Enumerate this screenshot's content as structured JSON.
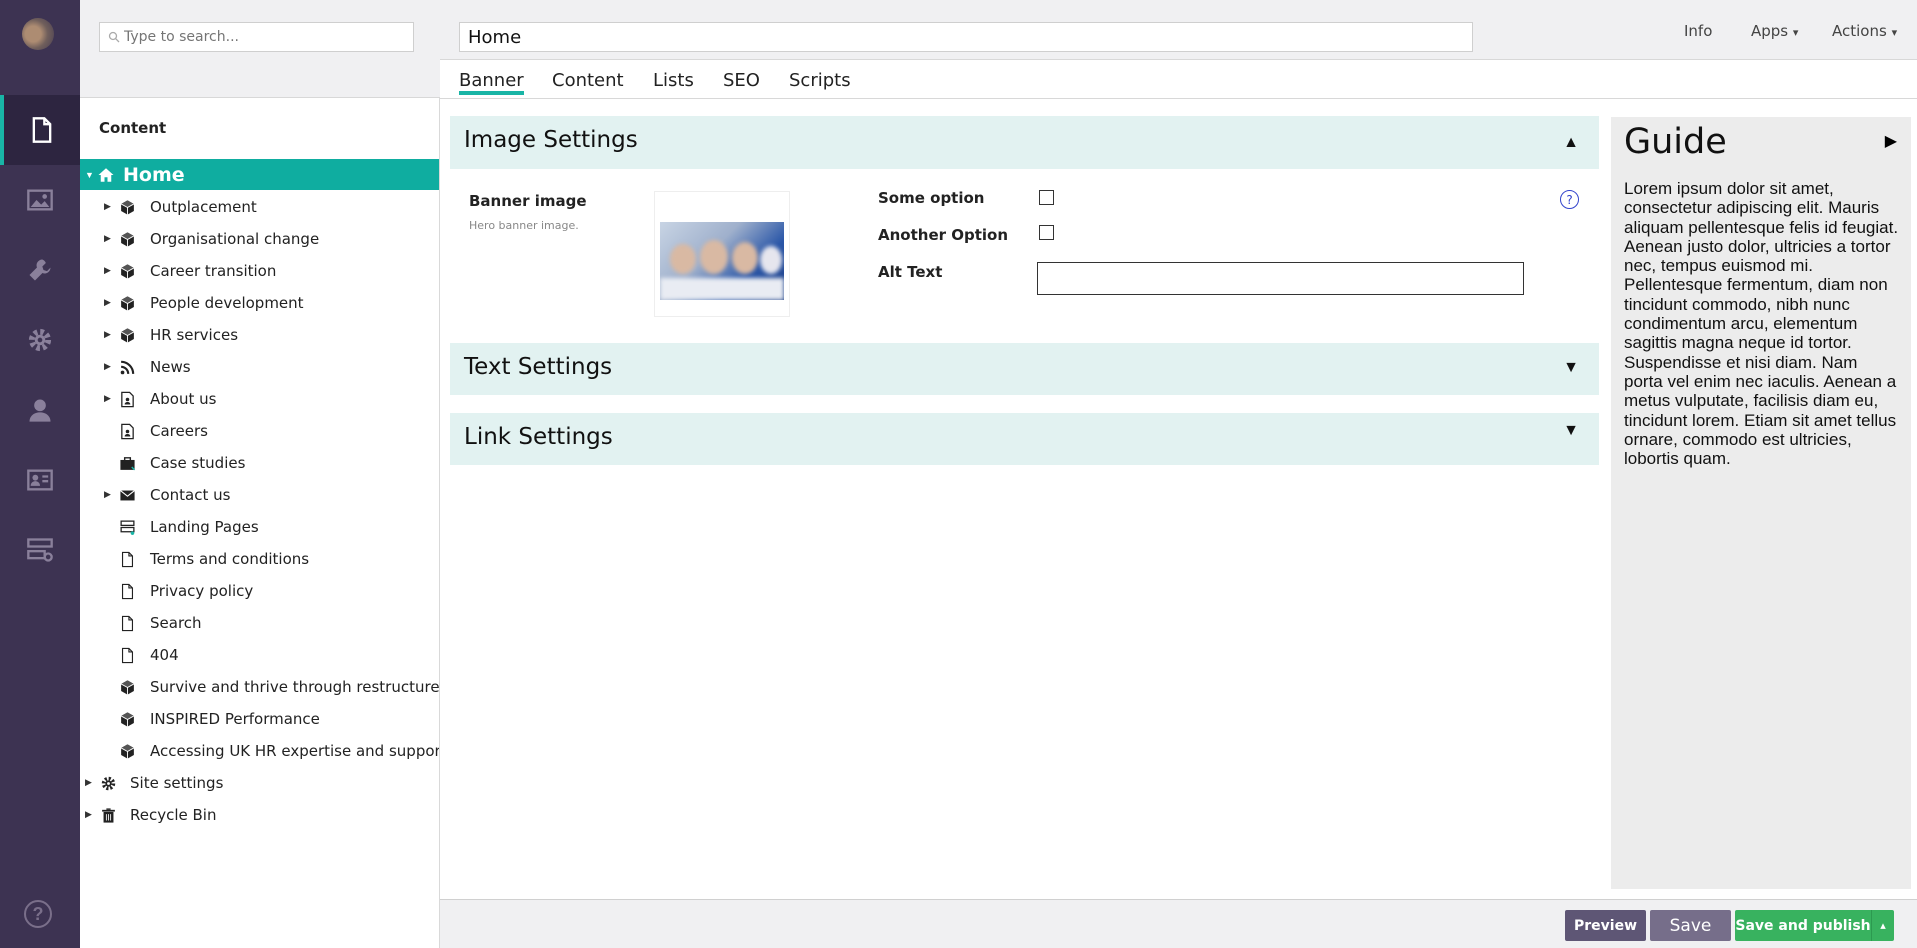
{
  "tree": {
    "search_placeholder": "Type to search...",
    "section_title": "Content",
    "home_label": "Home",
    "children": [
      {
        "label": "Outplacement",
        "icon": "box-icon",
        "expandable": true
      },
      {
        "label": "Organisational change",
        "icon": "box-icon",
        "expandable": true
      },
      {
        "label": "Career transition",
        "icon": "box-icon",
        "expandable": true
      },
      {
        "label": "People development",
        "icon": "box-icon",
        "expandable": true
      },
      {
        "label": "HR services",
        "icon": "box-icon",
        "expandable": true
      },
      {
        "label": "News",
        "icon": "rss-icon",
        "expandable": true
      },
      {
        "label": "About us",
        "icon": "page-person-icon",
        "expandable": true
      },
      {
        "label": "Careers",
        "icon": "page-person-icon",
        "expandable": false
      },
      {
        "label": "Case studies",
        "icon": "briefcase-icon",
        "expandable": false
      },
      {
        "label": "Contact us",
        "icon": "envelope-icon",
        "expandable": true
      },
      {
        "label": "Landing Pages",
        "icon": "layout-icon",
        "expandable": false
      },
      {
        "label": "Terms and conditions",
        "icon": "page-icon",
        "expandable": false
      },
      {
        "label": "Privacy policy",
        "icon": "page-icon",
        "expandable": false
      },
      {
        "label": "Search",
        "icon": "page-icon",
        "expandable": false
      },
      {
        "label": "404",
        "icon": "page-icon",
        "expandable": false
      },
      {
        "label": "Survive and thrive through restructures",
        "icon": "box-icon",
        "expandable": false
      },
      {
        "label": "INSPIRED Performance",
        "icon": "box-icon",
        "expandable": false
      },
      {
        "label": "Accessing UK HR expertise and support for",
        "icon": "box-icon",
        "expandable": false
      }
    ],
    "roots": [
      {
        "label": "Site settings",
        "icon": "gear-icon"
      },
      {
        "label": "Recycle Bin",
        "icon": "trash-icon"
      }
    ]
  },
  "header": {
    "node_name": "Home",
    "info_label": "Info",
    "apps_label": "Apps",
    "actions_label": "Actions",
    "dropdown_caret": "▾"
  },
  "tabs": [
    "Banner",
    "Content",
    "Lists",
    "SEO",
    "Scripts"
  ],
  "panels": {
    "image_settings": {
      "title": "Image Settings",
      "arrow": "▲",
      "banner_label": "Banner image",
      "banner_desc": "Hero banner image.",
      "some_option_label": "Some option",
      "another_option_label": "Another Option",
      "alt_text_label": "Alt Text",
      "alt_text_value": "",
      "help_glyph": "?"
    },
    "text_settings": {
      "title": "Text Settings",
      "arrow": "▼"
    },
    "link_settings": {
      "title": "Link Settings",
      "arrow": "▼"
    }
  },
  "guide": {
    "title": "Guide",
    "arrow": "▶",
    "text": "Lorem ipsum dolor sit amet, consectetur adipiscing elit. Mauris aliquam pellentesque felis id feugiat. Aenean justo dolor, ultricies a tortor nec, tempus euismod mi. Pellentesque fermentum, diam non tincidunt commodo, nibh nunc condimentum arcu, elementum sagittis magna neque id tortor. Suspendisse et nisi diam. Nam porta vel enim nec iaculis. Aenean a metus vulputate, facilisis diam eu, tincidunt lorem. Etiam sit amet tellus ornare, commodo est ultricies, lobortis quam."
  },
  "footer": {
    "preview_label": "Preview",
    "save_label": "Save",
    "publish_label": "Save and publish",
    "publish_caret": "▴"
  },
  "rail": {
    "help_glyph": "?",
    "items": [
      "content-icon",
      "media-icon",
      "wrench-icon",
      "settings-icon",
      "user-icon",
      "member-icon",
      "forms-icon"
    ]
  },
  "colors": {
    "rail_bg": "#3d3352",
    "accent": "#0fada0",
    "panel_header_bg": "#e2f2f1",
    "preview_btn": "#5e5675",
    "save_btn": "#766e8a",
    "publish_btn": "#38b25f"
  }
}
